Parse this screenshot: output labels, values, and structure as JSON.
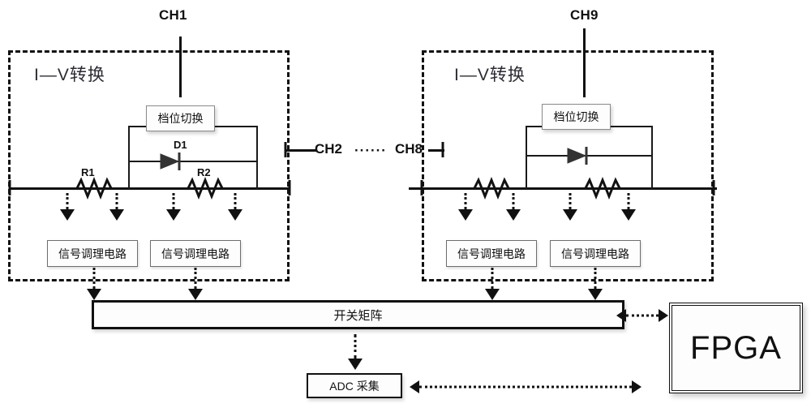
{
  "diagram": {
    "title_left_block": "I—V转换",
    "title_right_block": "I—V转换",
    "channels": {
      "first": "CH1",
      "middle_start": "CH2",
      "middle_dots": "······",
      "middle_end": "CH8",
      "last": "CH9"
    },
    "components": {
      "gain_switch": "档位切换",
      "resistor1": "R1",
      "resistor2": "R2",
      "diode1": "D1",
      "signal_conditioning": "信号调理电路",
      "switch_matrix": "开关矩阵",
      "adc": "ADC 采集",
      "fpga": "FPGA"
    },
    "blocks": {
      "left": {
        "label": "I—V转换",
        "channel": "CH1",
        "gain_switch": "档位切换",
        "diode": "D1",
        "resistors": [
          "R1",
          "R2"
        ],
        "conditioners": [
          "信号调理电路",
          "信号调理电路"
        ]
      },
      "right": {
        "label": "I—V转换",
        "channel": "CH9",
        "gain_switch": "档位切换",
        "diode": "",
        "resistors": [
          "",
          ""
        ],
        "conditioners": [
          "信号调理电路",
          "信号调理电路"
        ]
      }
    },
    "colors": {
      "line": "#111111",
      "box_fill": "#fdfdfd",
      "box_border": "#6e6e6e",
      "text": "#111111",
      "iv_label": "#2b2b33"
    }
  }
}
